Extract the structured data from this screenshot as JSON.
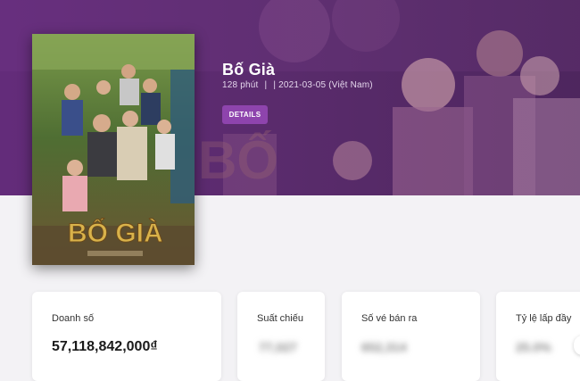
{
  "movie": {
    "title": "Bố Già",
    "duration": "128 phút",
    "separator": "|",
    "release": "| 2021-03-05 (Việt Nam)",
    "details_label": "DETAILS",
    "poster_title_text": "BỐ GIÀ"
  },
  "stats": [
    {
      "label": "Doanh số",
      "value": "57,118,842,000₫"
    },
    {
      "label": "Suất chiếu",
      "value": "77,027"
    },
    {
      "label": "Số vé bán ra",
      "value": "652,314"
    },
    {
      "label": "Tỷ lệ lấp đầy",
      "value": "25.0%"
    }
  ],
  "colors": {
    "accent": "#8e44ad",
    "hero_purple": "#6a2f7c",
    "page_bg": "#f3f2f5"
  }
}
